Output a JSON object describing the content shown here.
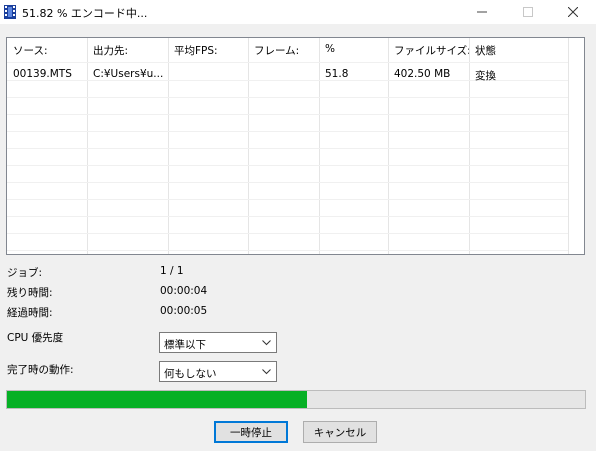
{
  "window": {
    "title": "51.82 % エンコード中...",
    "icon": "film-strip-icon"
  },
  "table": {
    "columns": [
      "ソース:",
      "出力先:",
      "平均FPS:",
      "フレーム:",
      "%",
      "ファイルサイズ:",
      "状態"
    ],
    "rows": [
      [
        "00139.MTS",
        "C:¥Users¥u...",
        "",
        "",
        "51.8",
        "402.50 MB",
        "変換"
      ]
    ]
  },
  "info": {
    "job_label": "ジョブ:",
    "job_value": "1 / 1",
    "remaining_label": "残り時間:",
    "remaining_value": "00:00:04",
    "elapsed_label": "経過時間:",
    "elapsed_value": "00:00:05"
  },
  "priority": {
    "label": "CPU 優先度",
    "selected": "標準以下"
  },
  "on_complete": {
    "label": "完了時の動作:",
    "selected": "何もしない"
  },
  "progress": {
    "fraction": 0.5182,
    "color": "#06b025"
  },
  "buttons": {
    "pause": "一時停止",
    "cancel": "キャンセル"
  },
  "colors": {
    "accent": "#0078d7"
  }
}
